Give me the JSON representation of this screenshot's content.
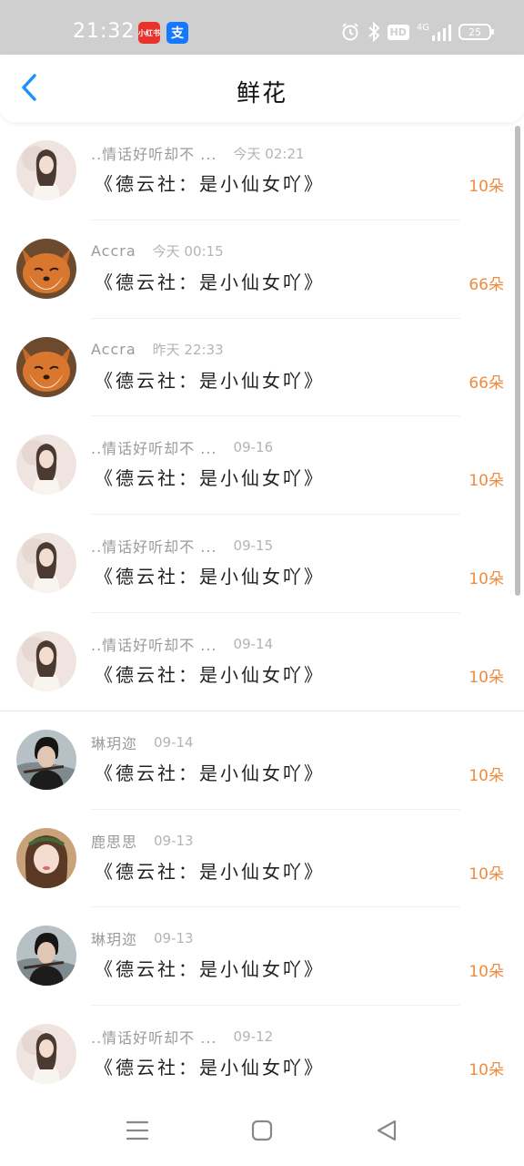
{
  "status_bar": {
    "time": "21:32",
    "badge_red_label": "小红书",
    "badge_blue_label": "支",
    "network": "4G",
    "hd": "HD",
    "battery": "25"
  },
  "header": {
    "title": "鲜花",
    "back_icon": "chevron-left-icon"
  },
  "colors": {
    "accent": "#1e90ff",
    "count": "#f08a3e",
    "status_bar_bg": "#cfcfcf"
  },
  "records": [
    {
      "name": "..情话好听却不 ...",
      "time": "今天 02:21",
      "gift": "《德云社：是小仙女吖》",
      "count": "10朵",
      "avatar": "woman"
    },
    {
      "name": "Accra",
      "time": "今天 00:15",
      "gift": "《德云社：是小仙女吖》",
      "count": "66朵",
      "avatar": "fox"
    },
    {
      "name": "Accra",
      "time": "昨天 22:33",
      "gift": "《德云社：是小仙女吖》",
      "count": "66朵",
      "avatar": "fox"
    },
    {
      "name": "..情话好听却不 ...",
      "time": "09-16",
      "gift": "《德云社：是小仙女吖》",
      "count": "10朵",
      "avatar": "woman"
    },
    {
      "name": "..情话好听却不 ...",
      "time": "09-15",
      "gift": "《德云社：是小仙女吖》",
      "count": "10朵",
      "avatar": "woman"
    },
    {
      "name": "..情话好听却不 ...",
      "time": "09-14",
      "gift": "《德云社：是小仙女吖》",
      "count": "10朵",
      "avatar": "woman"
    },
    {
      "name": "琳玥迩",
      "time": "09-14",
      "gift": "《德云社：是小仙女吖》",
      "count": "10朵",
      "avatar": "man"
    },
    {
      "name": "鹿思思",
      "time": "09-13",
      "gift": "《德云社：是小仙女吖》",
      "count": "10朵",
      "avatar": "girl"
    },
    {
      "name": "琳玥迩",
      "time": "09-13",
      "gift": "《德云社：是小仙女吖》",
      "count": "10朵",
      "avatar": "man"
    },
    {
      "name": "..情话好听却不 ...",
      "time": "09-12",
      "gift": "《德云社：是小仙女吖》",
      "count": "10朵",
      "avatar": "woman"
    }
  ],
  "nav": {
    "menu_icon": "menu-icon",
    "home_icon": "home-square-icon",
    "back_icon": "back-triangle-icon"
  }
}
